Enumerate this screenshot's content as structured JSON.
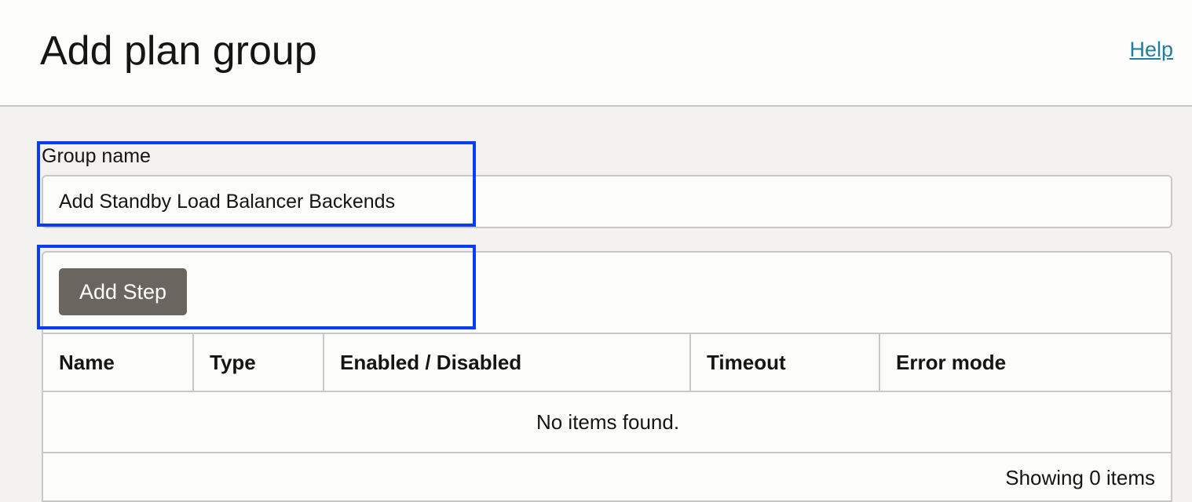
{
  "header": {
    "title": "Add plan group",
    "help_label": "Help"
  },
  "form": {
    "group_name_label": "Group name",
    "group_name_value": "Add Standby Load Balancer Backends"
  },
  "steps": {
    "add_step_label": "Add Step",
    "columns": [
      "Name",
      "Type",
      "Enabled / Disabled",
      "Timeout",
      "Error mode"
    ],
    "empty_message": "No items found.",
    "footer_count": "Showing 0 items"
  },
  "colors": {
    "highlight_border": "#0a3ded",
    "button_bg": "#6b6560",
    "link": "#227e9e"
  }
}
